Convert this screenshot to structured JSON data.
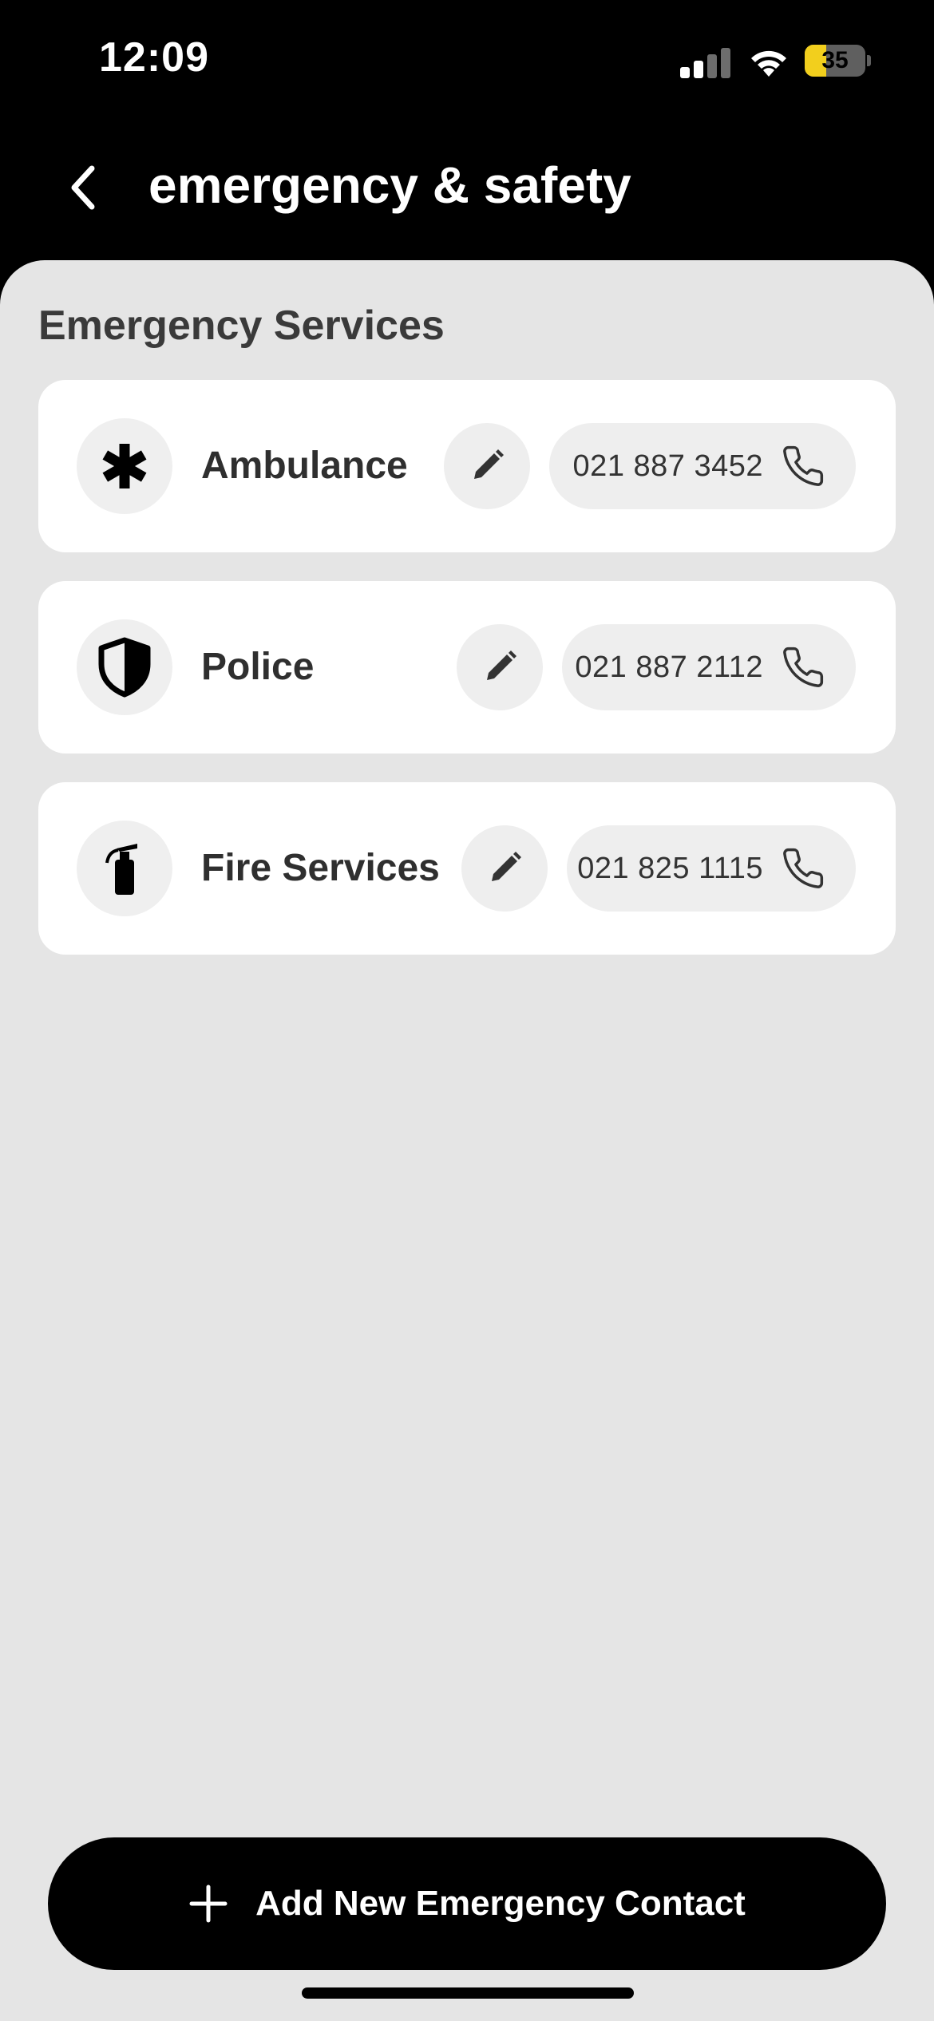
{
  "status_bar": {
    "time": "12:09",
    "battery_level": "35",
    "battery_fraction": 0.35
  },
  "header": {
    "title": "emergency & safety"
  },
  "section": {
    "title": "Emergency Services"
  },
  "contacts": [
    {
      "name": "Ambulance",
      "phone": "021 887 3452",
      "icon": "asterisk-icon"
    },
    {
      "name": "Police",
      "phone": "021 887 2112",
      "icon": "shield-icon"
    },
    {
      "name": "Fire Services",
      "phone": "021 825 1115",
      "icon": "fire-extinguisher-icon"
    }
  ],
  "add_button": {
    "label": "Add New Emergency Contact"
  },
  "colors": {
    "background": "#000000",
    "sheet": "#e5e5e5",
    "card": "#ffffff",
    "battery_accent": "#f2cf1d"
  }
}
